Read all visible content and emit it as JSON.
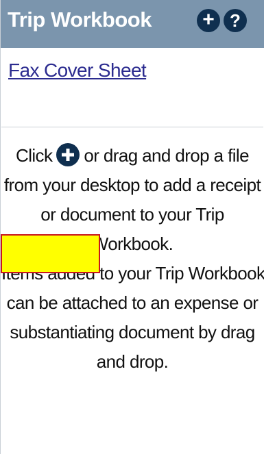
{
  "panel": {
    "title": "Trip Workbook",
    "add_icon": "plus-circle-icon",
    "help_icon": "question-circle-icon",
    "help_glyph": "?"
  },
  "documents": [
    {
      "label": "Fax Cover Sheet"
    }
  ],
  "instructions": {
    "click_text": "Click",
    "inline_icon": "plus-circle-icon",
    "line1_rest": "or drag and drop a file",
    "line2": "from your desktop to add a receipt",
    "line3": "or document to your Trip",
    "line4": "Workbook.",
    "line5": "Items added to your Trip Workbook",
    "line6": "can be attached to an expense or",
    "line7": "substantiating document by drag",
    "line8": "and drop."
  },
  "colors": {
    "header_bg": "#7b95ad",
    "icon_bg": "#0f2f4f",
    "link": "#2b2b8f",
    "redaction_fill": "#ffff00",
    "redaction_border": "#c8161e"
  }
}
